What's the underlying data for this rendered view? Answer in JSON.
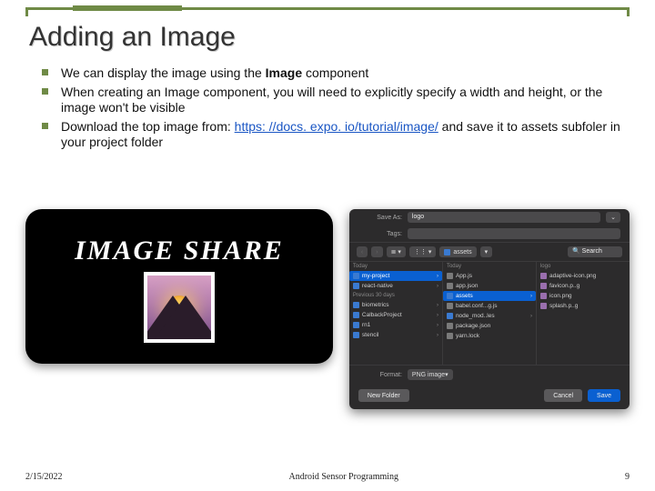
{
  "title": "Adding an Image",
  "bullets": [
    {
      "prefix": "We can display the image using the ",
      "bold": "Image",
      "suffix": " component"
    },
    {
      "text": "When creating an Image component, you will need to explicitly specify a width and height, or the image won't be visible"
    },
    {
      "prefix": "Download the top image from: ",
      "link": "https: //docs. expo. io/tutorial/image/",
      "suffix2": " and save it to assets subfoler in your project folder"
    }
  ],
  "imageshare": {
    "label": "IMAGE SHARE"
  },
  "dialog": {
    "saveas_label": "Save As:",
    "saveas_value": "logo",
    "tags_label": "Tags:",
    "nav_back": "‹",
    "nav_fwd": "›",
    "view1": "≣ ▾",
    "view2": "⋮⋮ ▾",
    "folder_dd": "assets",
    "updown": "▾",
    "search_placeholder": "Search",
    "col1_head": "Today",
    "col2_head": "Today",
    "col3_head": "logo",
    "col1": [
      {
        "name": "my-project",
        "type": "folder",
        "sel": true
      },
      {
        "name": "react-native",
        "type": "folder"
      }
    ],
    "col1_head2": "Previous 30 days",
    "col1b": [
      {
        "name": "biometrics",
        "type": "folder"
      },
      {
        "name": "CalbackProject",
        "type": "folder"
      },
      {
        "name": "rn1",
        "type": "folder"
      },
      {
        "name": "stencil",
        "type": "folder"
      }
    ],
    "col2": [
      {
        "name": "App.js",
        "type": "file"
      },
      {
        "name": "app.json",
        "type": "file"
      },
      {
        "name": "assets",
        "type": "folder",
        "sel": true
      },
      {
        "name": "babel.conf...g.js",
        "type": "file"
      },
      {
        "name": "node_mod..les",
        "type": "folder"
      },
      {
        "name": "package.json",
        "type": "file"
      },
      {
        "name": "yarn.lock",
        "type": "file"
      }
    ],
    "col3": [
      {
        "name": "adaptive-icon.png",
        "type": "img"
      },
      {
        "name": "favicon.p..g",
        "type": "img"
      },
      {
        "name": "icon.png",
        "type": "img"
      },
      {
        "name": "splash.p..g",
        "type": "img"
      }
    ],
    "preview_size": "logo",
    "format_label": "Format:",
    "format_value": "PNG image",
    "newfolder": "New Folder",
    "cancel": "Cancel",
    "save": "Save"
  },
  "footer": {
    "date": "2/15/2022",
    "center": "Android Sensor Programming",
    "page": "9"
  }
}
